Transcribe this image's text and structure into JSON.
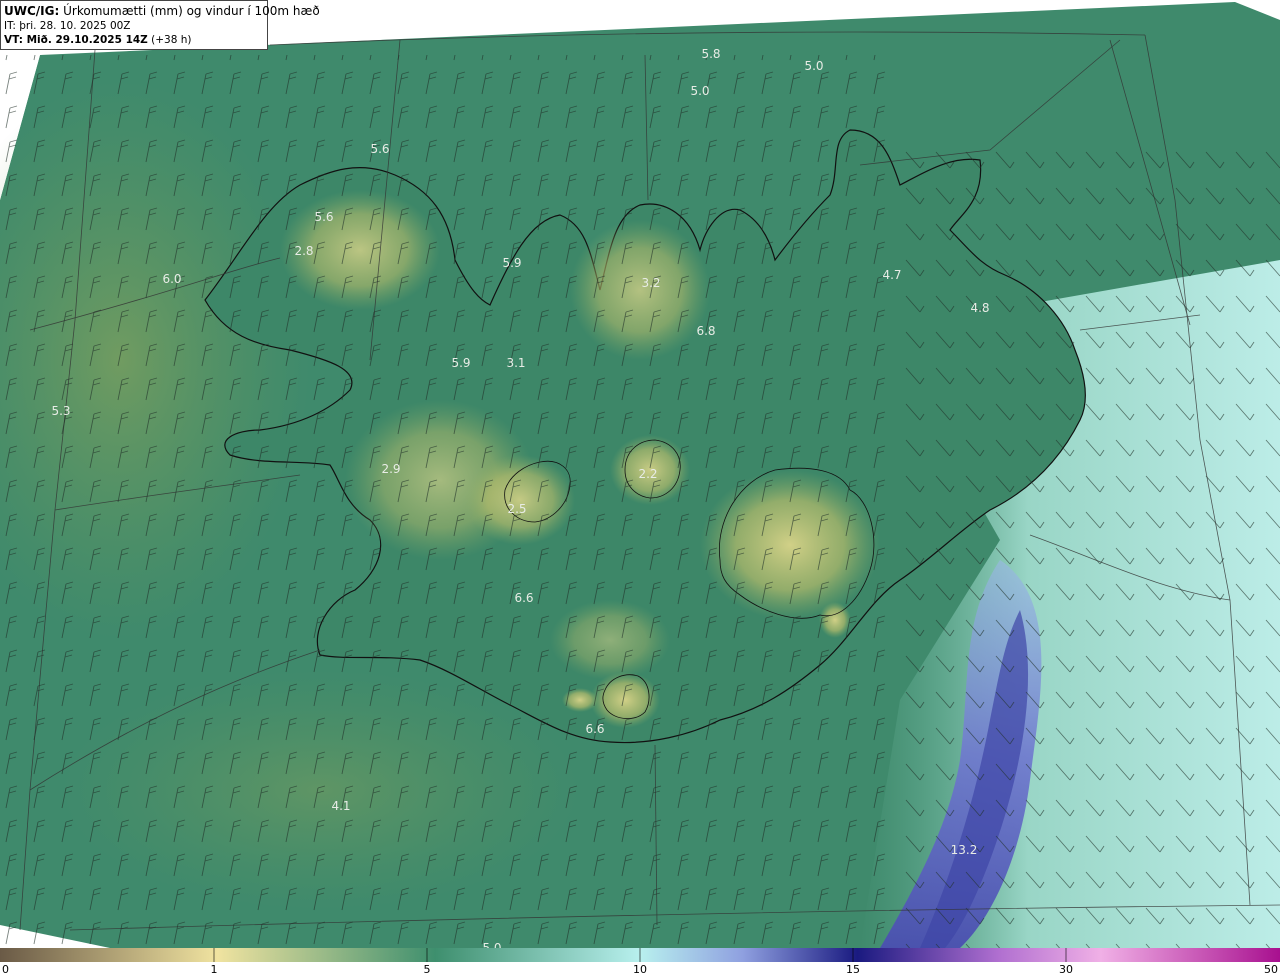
{
  "header": {
    "model": "UWC/IG:",
    "title": "Úrkomumætti (mm) og vindur í 100m hæð",
    "issue_time": "IT: þri. 28. 10. 2025 00Z",
    "valid_prefix": "VT:",
    "valid_time": "Mið. 29.10.2025 14Z",
    "lead_time": "(+38 h)"
  },
  "colorbar": {
    "ticks": [
      "0",
      "1",
      "5",
      "10",
      "15",
      "30",
      "50"
    ]
  },
  "labels": [
    {
      "id": "l01",
      "text": "5.8"
    },
    {
      "id": "l02",
      "text": "5.0"
    },
    {
      "id": "l03",
      "text": "5.0"
    },
    {
      "id": "l04",
      "text": "5.6"
    },
    {
      "id": "l05",
      "text": "5.6"
    },
    {
      "id": "l06",
      "text": "2.8"
    },
    {
      "id": "l07",
      "text": "6.0"
    },
    {
      "id": "l08",
      "text": "5.9"
    },
    {
      "id": "l09",
      "text": "3.2"
    },
    {
      "id": "l10",
      "text": "4.7"
    },
    {
      "id": "l11",
      "text": "4.8"
    },
    {
      "id": "l12",
      "text": "6.8"
    },
    {
      "id": "l13",
      "text": "5.9"
    },
    {
      "id": "l14",
      "text": "3.1"
    },
    {
      "id": "l15",
      "text": "5.3"
    },
    {
      "id": "l16",
      "text": "2.9"
    },
    {
      "id": "l17",
      "text": "2.2"
    },
    {
      "id": "l18",
      "text": "2.5"
    },
    {
      "id": "l19",
      "text": "6.6"
    },
    {
      "id": "l20",
      "text": "6.6"
    },
    {
      "id": "l21",
      "text": "4.1"
    },
    {
      "id": "l22",
      "text": "13.2"
    },
    {
      "id": "l23",
      "text": "5.0"
    }
  ],
  "colors": {
    "ocean_base": "#3f8a6c",
    "west_ocean": "#5c9a5e",
    "land_base": "#3d8768",
    "highland": "#b7bd6c",
    "glacier": "#d9d489",
    "east_sea": "#a9e3d6",
    "precip_light": "#bdeff0",
    "precip_mid": "#8fa8e0",
    "precip_heavy": "#4a4fb0",
    "coast": "#111111",
    "label_color": "#e8ece6"
  }
}
